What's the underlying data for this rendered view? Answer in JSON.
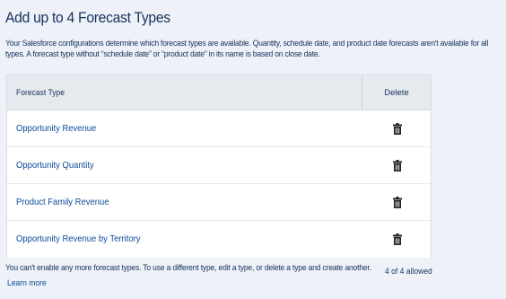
{
  "page": {
    "title": "Add up to 4 Forecast Types",
    "description": "Your Salesforce configurations determine which forecast types are available. Quantity, schedule date, and product date forecasts aren't available for all types. A forecast type without “schedule date” or “product date” in its name is based on close date."
  },
  "table": {
    "col_type": "Forecast Type",
    "col_delete": "Delete",
    "rows": [
      {
        "name": "Opportunity Revenue",
        "delete_icon": "trash-icon"
      },
      {
        "name": "Opportunity Quantity",
        "delete_icon": "trash-icon"
      },
      {
        "name": "Product Family Revenue",
        "delete_icon": "trash-icon"
      },
      {
        "name": "Opportunity Revenue by Territory",
        "delete_icon": "trash-icon"
      }
    ]
  },
  "footer": {
    "note": "You can't enable any more forecast types. To use a different type, edit a type, or delete a type and create another.",
    "allowed": "4 of 4 allowed",
    "learn_more": "Learn more"
  },
  "colors": {
    "background": "#eef1f8",
    "link": "#0a4b9a",
    "text": "#16325c",
    "header_bg": "#e6e9ee"
  }
}
